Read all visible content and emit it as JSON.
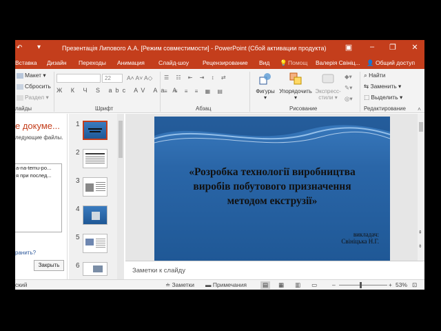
{
  "titlebar": {
    "title": "Презентація Липового А.А. [Режим совместимости] - PowerPoint (Сбой активации продукта)"
  },
  "tabs": [
    "Вставка",
    "Дизайн",
    "Переходы",
    "Анимация",
    "Слайд-шоу",
    "Рецензирование",
    "Вид"
  ],
  "tell_me": "Помощ",
  "user": "Валерія Свініц...",
  "share": "Общий доступ",
  "ribbon": {
    "slides": {
      "layout": "Макет",
      "reset": "Сбросить",
      "section": "Раздел",
      "label": "лайды"
    },
    "font": {
      "size": "22",
      "label": "Шрифт",
      "format_buttons": "Ж К Ч S abc AV Aa A"
    },
    "paragraph": {
      "label": "Абзац"
    },
    "drawing": {
      "shapes": "Фигуры",
      "arrange": "Упорядочить",
      "quick_styles": "Экспресс-",
      "quick_styles_2": "стили",
      "label": "Рисование"
    },
    "editing": {
      "find": "Найти",
      "replace": "Заменить",
      "select": "Выделить",
      "label": "Редактирование"
    }
  },
  "taskpane": {
    "title": "е докуме...",
    "subtitle": "ледующие файлы.",
    "lines": [
      "a-na-temu-po...",
      "я при послед..."
    ],
    "link": "ранить?",
    "close": "Закрыть"
  },
  "thumbnails": [
    {
      "num": "1",
      "selected": true
    },
    {
      "num": "2",
      "selected": false
    },
    {
      "num": "3",
      "selected": false
    },
    {
      "num": "4",
      "selected": false
    },
    {
      "num": "5",
      "selected": false
    },
    {
      "num": "6",
      "selected": false
    }
  ],
  "slide": {
    "title_lines": [
      "«Розробка технології виробництва",
      "виробів побутового призначення",
      "методом екструзії»"
    ],
    "author_lines": [
      "викладач:",
      "Свініцька Н.Г."
    ]
  },
  "notes": {
    "placeholder": "Заметки к слайду"
  },
  "status": {
    "lang": "ский",
    "notes_btn": "Заметки",
    "comments_btn": "Примечания",
    "zoom": "53%",
    "zoom_level": 0.44
  },
  "colors": {
    "accent": "#c43e1c",
    "slide_bg": "#2a66a8"
  }
}
